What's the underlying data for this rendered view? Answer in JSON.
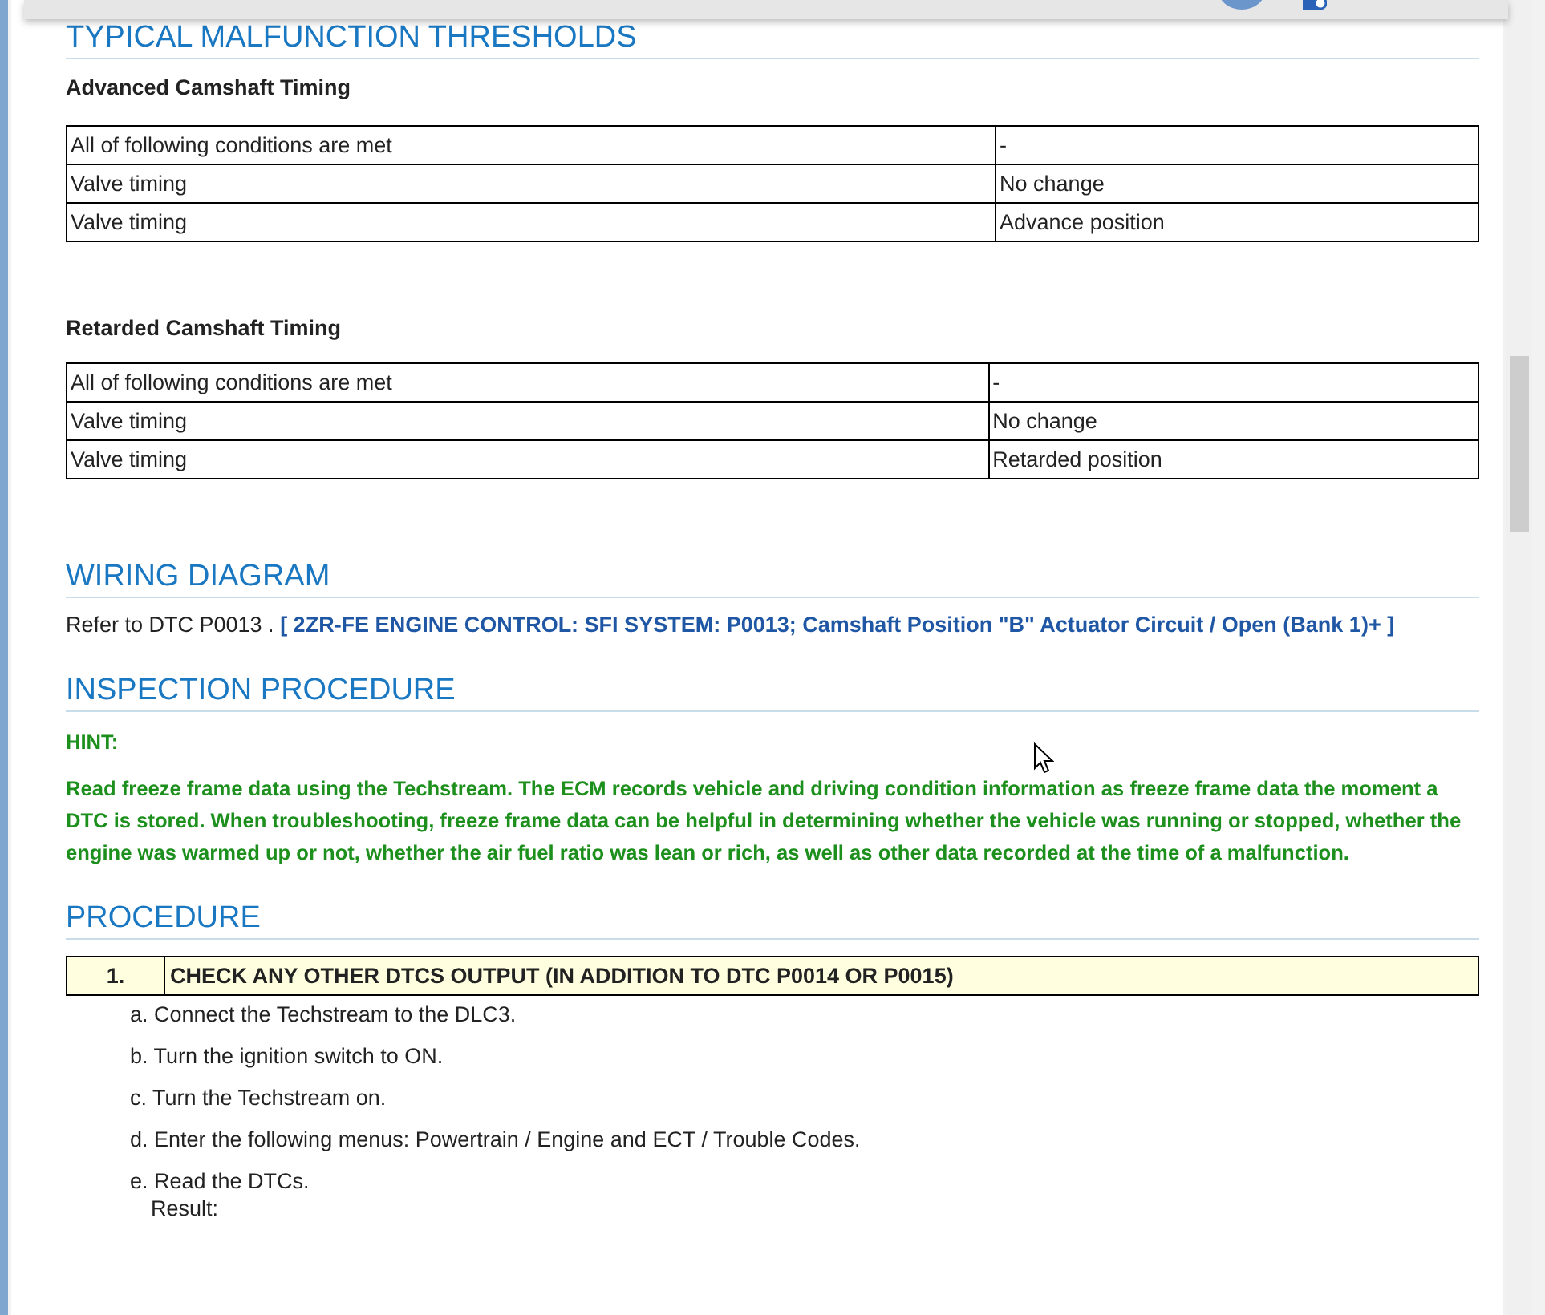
{
  "thresholds": {
    "heading": "TYPICAL MALFUNCTION THRESHOLDS",
    "tables": [
      {
        "title": "Advanced Camshaft Timing",
        "rows": [
          [
            "All of following conditions are met",
            "-"
          ],
          [
            "Valve timing",
            "No change"
          ],
          [
            "Valve timing",
            "Advance position"
          ]
        ]
      },
      {
        "title": "Retarded Camshaft Timing",
        "rows": [
          [
            "All of following conditions are met",
            "-"
          ],
          [
            "Valve timing",
            "No change"
          ],
          [
            "Valve timing",
            "Retarded position"
          ]
        ]
      }
    ]
  },
  "wiring": {
    "heading": "WIRING DIAGRAM",
    "text": "Refer to DTC P0013 .",
    "link": "[ 2ZR-FE ENGINE CONTROL: SFI SYSTEM: P0013; Camshaft Position \"B\" Actuator Circuit / Open (Bank 1)+ ]"
  },
  "inspection": {
    "heading": "INSPECTION PROCEDURE",
    "hint_label": "HINT:",
    "hint": "Read freeze frame data using the Techstream. The ECM records vehicle and driving condition information as freeze frame data the moment a DTC is stored. When troubleshooting, freeze frame data can be helpful in determining whether the vehicle was running or stopped, whether the engine was warmed up or not, whether the air fuel ratio was lean or rich, as well as other data recorded at the time of a malfunction."
  },
  "procedure": {
    "heading": "PROCEDURE",
    "step": {
      "number": "1.",
      "title": "CHECK ANY OTHER DTCS OUTPUT (IN ADDITION TO DTC P0014 OR P0015)"
    },
    "items": [
      {
        "text": "a. Connect the Techstream to the DLC3."
      },
      {
        "text": "b. Turn the ignition switch to ON."
      },
      {
        "text": "c. Turn the Techstream on."
      },
      {
        "text": "d. Enter the following menus: Powertrain / Engine and ECT / Trouble Codes."
      },
      {
        "text": "e. Read the DTCs.",
        "note": "Result:"
      }
    ]
  }
}
